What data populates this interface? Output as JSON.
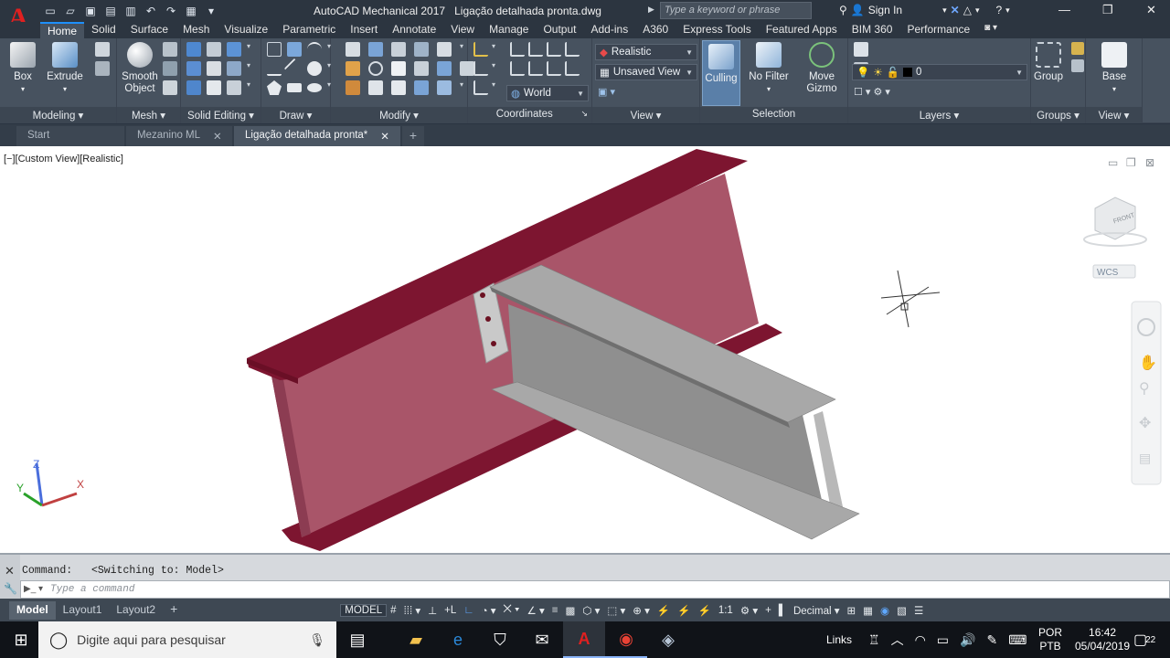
{
  "window": {
    "app_name": "AutoCAD Mechanical 2017",
    "file_name": "Ligação detalhada pronta.dwg",
    "search_placeholder": "Type a keyword or phrase",
    "signin_label": "Sign In"
  },
  "ribbon_tabs": [
    "Home",
    "Solid",
    "Surface",
    "Mesh",
    "Visualize",
    "Parametric",
    "Insert",
    "Annotate",
    "View",
    "Manage",
    "Output",
    "Add-ins",
    "A360",
    "Express Tools",
    "Featured Apps",
    "BIM 360",
    "Performance"
  ],
  "ribbon": {
    "box_label": "Box",
    "extrude_label": "Extrude",
    "smooth_label_1": "Smooth",
    "smooth_label_2": "Object",
    "visual_style": "Realistic",
    "view_name": "Unsaved View",
    "ucs_name": "World",
    "culling_label": "Culling",
    "nofilter_label": "No Filter",
    "move_label_1": "Move",
    "move_label_2": "Gizmo",
    "layer_value": "0",
    "group_label": "Group",
    "base_label": "Base",
    "panels": {
      "modeling": "Modeling",
      "mesh": "Mesh",
      "solid_editing": "Solid Editing",
      "draw": "Draw",
      "modify": "Modify",
      "coordinates": "Coordinates",
      "view": "View",
      "selection": "Selection",
      "layers": "Layers",
      "groups": "Groups",
      "view2": "View"
    }
  },
  "doc_tabs": [
    "Start",
    "Mezanino ML",
    "Ligação detalhada pronta*"
  ],
  "viewport": {
    "label": "[−][Custom View][Realistic]",
    "wcs_label": "WCS",
    "cube_face": "FRONT",
    "axis_x": "X",
    "axis_y": "Y",
    "axis_z": "Z"
  },
  "command": {
    "history_label": "Command:",
    "history_text": "<Switching to: Model>",
    "input_placeholder": "Type a command"
  },
  "layout_tabs": [
    "Model",
    "Layout1",
    "Layout2"
  ],
  "status": {
    "model": "MODEL",
    "scale": "1:1",
    "units": "Decimal"
  },
  "taskbar": {
    "search_placeholder": "Digite aqui para pesquisar",
    "links": "Links",
    "lang1": "POR",
    "lang2": "PTB",
    "time": "16:42",
    "date": "05/04/2019",
    "notif_count": "22"
  },
  "colors": {
    "main_beam_web": "#a95569",
    "main_beam_flange": "#7d1530",
    "secondary_beam": "#8f8f8f",
    "accent": "#1e90ff"
  }
}
